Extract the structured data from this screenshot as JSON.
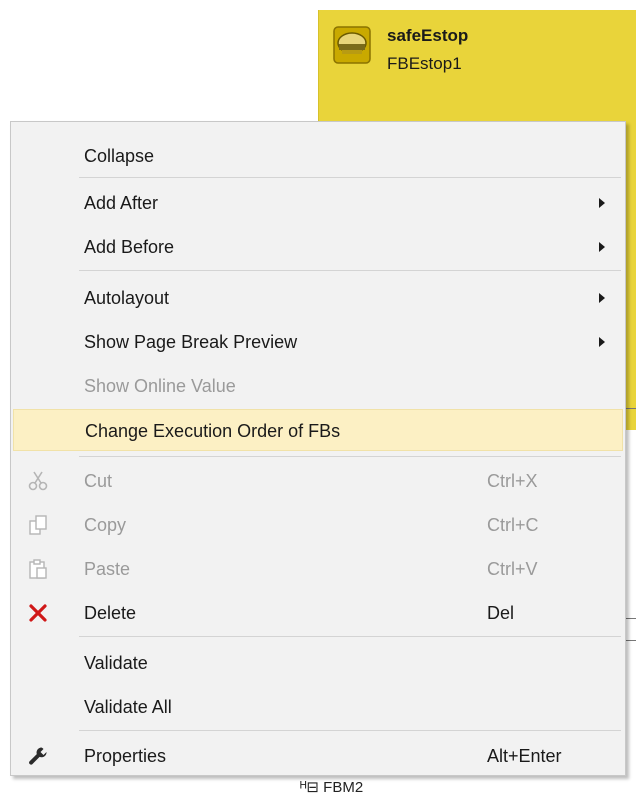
{
  "fb_block": {
    "title": "safeEstop",
    "name": "FBEstop1",
    "color": "#e9d43a",
    "icon": "emergency-stop-icon"
  },
  "background_peek": "ᴴ⊟ FBM2",
  "menu": {
    "items": [
      {
        "label": "Collapse",
        "shortcut": "",
        "submenu": false,
        "disabled": false,
        "icon": ""
      },
      {
        "label": "Add After",
        "shortcut": "",
        "submenu": true,
        "disabled": false,
        "icon": ""
      },
      {
        "label": "Add Before",
        "shortcut": "",
        "submenu": true,
        "disabled": false,
        "icon": ""
      },
      {
        "label": "Autolayout",
        "shortcut": "",
        "submenu": true,
        "disabled": false,
        "icon": ""
      },
      {
        "label": "Show Page Break Preview",
        "shortcut": "",
        "submenu": true,
        "disabled": false,
        "icon": ""
      },
      {
        "label": "Show Online Value",
        "shortcut": "",
        "submenu": false,
        "disabled": true,
        "icon": ""
      },
      {
        "label": "Change Execution Order of FBs",
        "shortcut": "",
        "submenu": false,
        "disabled": false,
        "highlighted": true,
        "icon": ""
      },
      {
        "label": "Cut",
        "shortcut": "Ctrl+X",
        "submenu": false,
        "disabled": true,
        "icon": "scissors-icon"
      },
      {
        "label": "Copy",
        "shortcut": "Ctrl+C",
        "submenu": false,
        "disabled": true,
        "icon": "copy-icon"
      },
      {
        "label": "Paste",
        "shortcut": "Ctrl+V",
        "submenu": false,
        "disabled": true,
        "icon": "paste-icon"
      },
      {
        "label": "Delete",
        "shortcut": "Del",
        "submenu": false,
        "disabled": false,
        "icon": "delete-x-icon"
      },
      {
        "label": "Validate",
        "shortcut": "",
        "submenu": false,
        "disabled": false,
        "icon": ""
      },
      {
        "label": "Validate All",
        "shortcut": "",
        "submenu": false,
        "disabled": false,
        "icon": ""
      },
      {
        "label": "Properties",
        "shortcut": "Alt+Enter",
        "submenu": false,
        "disabled": false,
        "icon": "wrench-icon"
      }
    ]
  }
}
